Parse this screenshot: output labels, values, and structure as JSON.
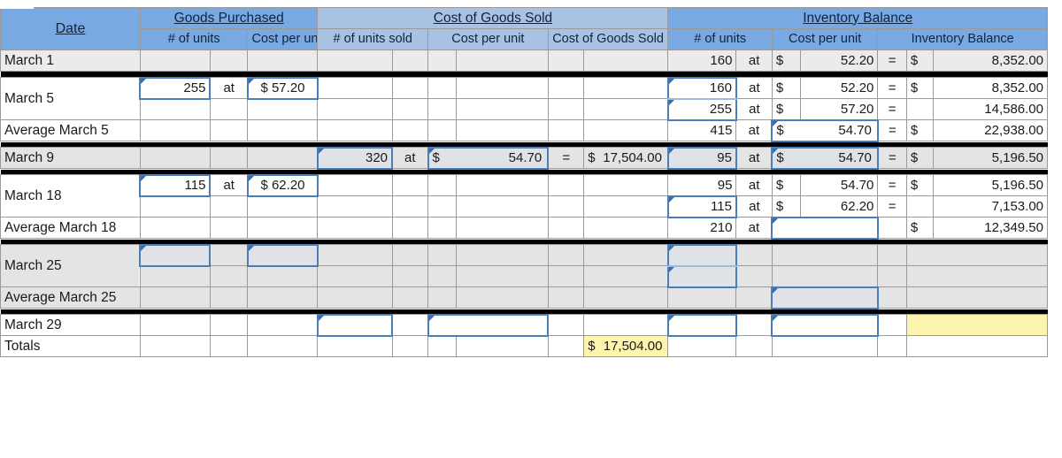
{
  "headers": {
    "date": "Date",
    "groups": {
      "goods_purchased": "Goods Purchased",
      "cost_of_goods_sold": "Cost of Goods Sold",
      "inventory_balance": "Inventory Balance"
    },
    "sub": {
      "gp_units": "# of units",
      "gp_cost_per_unit": "Cost per unit",
      "cogs_units_sold": "# of units sold",
      "cogs_cost_per_unit": "Cost per unit",
      "cogs_total": "Cost of Goods Sold",
      "inv_units": "# of units",
      "inv_cost_per_unit": "Cost per unit",
      "inv_balance": "Inventory Balance"
    }
  },
  "symbols": {
    "at": "at",
    "equals": "=",
    "dollar": "$",
    "blank": ""
  },
  "colors": {
    "header_blue": "#79a9e3",
    "header_blue_light": "#a9c2e3",
    "input_border": "#4a7ebb",
    "highlight_yellow": "#fdf4ad",
    "band_gray": "#e4e4e4"
  },
  "rows": [
    {
      "id": "march-1",
      "date": "March 1",
      "gp_units": "",
      "gp_at": "",
      "gp_cpu": "",
      "cogs_units": "",
      "cogs_at": "",
      "cogs_cpu_sym": "",
      "cogs_cpu": "",
      "cogs_eq": "",
      "cogs_sym": "",
      "cogs_total": "",
      "inv_units": "160",
      "inv_at": "at",
      "inv_cpu_sym": "$",
      "inv_cpu": "52.20",
      "inv_eq": "=",
      "inv_sym": "$",
      "inv_bal": "8,352.00"
    },
    {
      "id": "march-5-a",
      "date": "March 5",
      "gp_units": "255",
      "gp_at": "at",
      "gp_cpu": "$ 57.20",
      "cogs_units": "",
      "cogs_at": "",
      "cogs_cpu_sym": "",
      "cogs_cpu": "",
      "cogs_eq": "",
      "cogs_sym": "",
      "cogs_total": "",
      "inv_units": "160",
      "inv_at": "at",
      "inv_cpu_sym": "$",
      "inv_cpu": "52.20",
      "inv_eq": "=",
      "inv_sym": "$",
      "inv_bal": "8,352.00"
    },
    {
      "id": "march-5-b",
      "date": "",
      "gp_units": "",
      "gp_at": "",
      "gp_cpu": "",
      "cogs_units": "",
      "cogs_at": "",
      "cogs_cpu_sym": "",
      "cogs_cpu": "",
      "cogs_eq": "",
      "cogs_sym": "",
      "cogs_total": "",
      "inv_units": "255",
      "inv_at": "at",
      "inv_cpu_sym": "$",
      "inv_cpu": "57.20",
      "inv_eq": "=",
      "inv_sym": "",
      "inv_bal": "14,586.00"
    },
    {
      "id": "average-march-5",
      "date": "Average March 5",
      "gp_units": "",
      "gp_at": "",
      "gp_cpu": "",
      "cogs_units": "",
      "cogs_at": "",
      "cogs_cpu_sym": "",
      "cogs_cpu": "",
      "cogs_eq": "",
      "cogs_sym": "",
      "cogs_total": "",
      "inv_units": "415",
      "inv_at": "at",
      "inv_cpu_sym": "$",
      "inv_cpu": "54.70",
      "inv_eq": "=",
      "inv_sym": "$",
      "inv_bal": "22,938.00"
    },
    {
      "id": "march-9",
      "date": "March 9",
      "gp_units": "",
      "gp_at": "",
      "gp_cpu": "",
      "cogs_units": "320",
      "cogs_at": "at",
      "cogs_cpu_sym": "$",
      "cogs_cpu": "54.70",
      "cogs_eq": "=",
      "cogs_sym": "$",
      "cogs_total": "17,504.00",
      "inv_units": "95",
      "inv_at": "at",
      "inv_cpu_sym": "$",
      "inv_cpu": "54.70",
      "inv_eq": "=",
      "inv_sym": "$",
      "inv_bal": "5,196.50"
    },
    {
      "id": "march-18-a",
      "date": "March 18",
      "gp_units": "115",
      "gp_at": "at",
      "gp_cpu": "$ 62.20",
      "cogs_units": "",
      "cogs_at": "",
      "cogs_cpu_sym": "",
      "cogs_cpu": "",
      "cogs_eq": "",
      "cogs_sym": "",
      "cogs_total": "",
      "inv_units": "95",
      "inv_at": "at",
      "inv_cpu_sym": "$",
      "inv_cpu": "54.70",
      "inv_eq": "=",
      "inv_sym": "$",
      "inv_bal": "5,196.50"
    },
    {
      "id": "march-18-b",
      "date": "",
      "gp_units": "",
      "gp_at": "",
      "gp_cpu": "",
      "cogs_units": "",
      "cogs_at": "",
      "cogs_cpu_sym": "",
      "cogs_cpu": "",
      "cogs_eq": "",
      "cogs_sym": "",
      "cogs_total": "",
      "inv_units": "115",
      "inv_at": "at",
      "inv_cpu_sym": "$",
      "inv_cpu": "62.20",
      "inv_eq": "=",
      "inv_sym": "",
      "inv_bal": "7,153.00"
    },
    {
      "id": "average-march-18",
      "date": "Average March 18",
      "gp_units": "",
      "gp_at": "",
      "gp_cpu": "",
      "cogs_units": "",
      "cogs_at": "",
      "cogs_cpu_sym": "",
      "cogs_cpu": "",
      "cogs_eq": "",
      "cogs_sym": "",
      "cogs_total": "",
      "inv_units": "210",
      "inv_at": "at",
      "inv_cpu_sym": "",
      "inv_cpu": "",
      "inv_eq": "",
      "inv_sym": "$",
      "inv_bal": "12,349.50"
    },
    {
      "id": "march-25-a",
      "date": "March 25",
      "gp_units": "",
      "gp_at": "",
      "gp_cpu": "",
      "cogs_units": "",
      "cogs_at": "",
      "cogs_cpu_sym": "",
      "cogs_cpu": "",
      "cogs_eq": "",
      "cogs_sym": "",
      "cogs_total": "",
      "inv_units": "",
      "inv_at": "",
      "inv_cpu_sym": "",
      "inv_cpu": "",
      "inv_eq": "",
      "inv_sym": "",
      "inv_bal": ""
    },
    {
      "id": "march-25-b",
      "date": "",
      "gp_units": "",
      "gp_at": "",
      "gp_cpu": "",
      "cogs_units": "",
      "cogs_at": "",
      "cogs_cpu_sym": "",
      "cogs_cpu": "",
      "cogs_eq": "",
      "cogs_sym": "",
      "cogs_total": "",
      "inv_units": "",
      "inv_at": "",
      "inv_cpu_sym": "",
      "inv_cpu": "",
      "inv_eq": "",
      "inv_sym": "",
      "inv_bal": ""
    },
    {
      "id": "average-march-25",
      "date": "Average March 25",
      "gp_units": "",
      "gp_at": "",
      "gp_cpu": "",
      "cogs_units": "",
      "cogs_at": "",
      "cogs_cpu_sym": "",
      "cogs_cpu": "",
      "cogs_eq": "",
      "cogs_sym": "",
      "cogs_total": "",
      "inv_units": "",
      "inv_at": "",
      "inv_cpu_sym": "",
      "inv_cpu": "",
      "inv_eq": "",
      "inv_sym": "",
      "inv_bal": ""
    },
    {
      "id": "march-29",
      "date": "March 29",
      "gp_units": "",
      "gp_at": "",
      "gp_cpu": "",
      "cogs_units": "",
      "cogs_at": "",
      "cogs_cpu_sym": "",
      "cogs_cpu": "",
      "cogs_eq": "",
      "cogs_sym": "",
      "cogs_total": "",
      "inv_units": "",
      "inv_at": "",
      "inv_cpu_sym": "",
      "inv_cpu": "",
      "inv_eq": "",
      "inv_sym": "",
      "inv_bal": ""
    },
    {
      "id": "totals",
      "date": "Totals",
      "gp_units": "",
      "gp_at": "",
      "gp_cpu": "",
      "cogs_units": "",
      "cogs_at": "",
      "cogs_cpu_sym": "",
      "cogs_cpu": "",
      "cogs_eq": "",
      "cogs_sym": "$",
      "cogs_total": "17,504.00",
      "inv_units": "",
      "inv_at": "",
      "inv_cpu_sym": "",
      "inv_cpu": "",
      "inv_eq": "",
      "inv_sym": "",
      "inv_bal": ""
    }
  ]
}
